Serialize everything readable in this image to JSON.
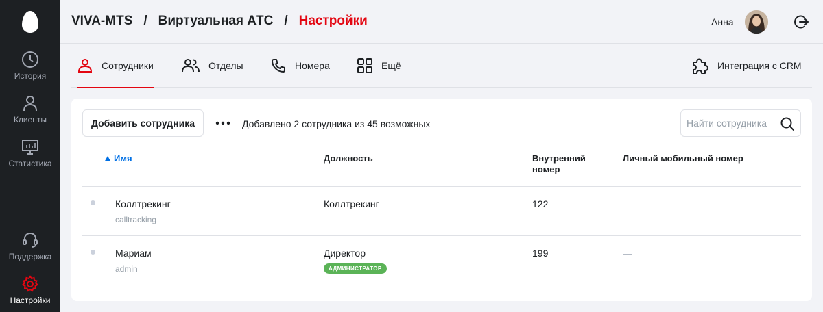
{
  "sidebar": {
    "items": [
      {
        "label": "История",
        "icon": "clock-icon"
      },
      {
        "label": "Клиенты",
        "icon": "person-icon"
      },
      {
        "label": "Статистика",
        "icon": "monitor-chart-icon"
      },
      {
        "label": "Поддержка",
        "icon": "headset-icon"
      },
      {
        "label": "Настройки",
        "icon": "gear-icon",
        "active": true
      }
    ]
  },
  "header": {
    "breadcrumb": [
      "VIVA-MTS",
      "Виртуальная АТС",
      "Настройки"
    ],
    "separator": "/",
    "user_name": "Анна"
  },
  "tabs": [
    {
      "label": "Сотрудники",
      "icon": "employee-icon",
      "active": true
    },
    {
      "label": "Отделы",
      "icon": "people-icon"
    },
    {
      "label": "Номера",
      "icon": "phone-icon"
    },
    {
      "label": "Ещё",
      "icon": "grid-icon"
    },
    {
      "label": "Интеграция с CRM",
      "icon": "puzzle-icon"
    }
  ],
  "toolbar": {
    "add_label": "Добавить сотрудника",
    "added_text": "Добавлено 2 сотрудника из 45 возможных",
    "search_placeholder": "Найти сотрудника"
  },
  "table": {
    "headers": {
      "name": "Имя",
      "position": "Должность",
      "ext_line1": "Внутренний",
      "ext_line2": "номер",
      "mobile": "Личный мобильный номер"
    },
    "rows": [
      {
        "name": "Коллтрекинг",
        "login": "calltracking",
        "position": "Коллтрекинг",
        "badge": "",
        "ext": "122",
        "mobile": "—"
      },
      {
        "name": "Мариам",
        "login": "admin",
        "position": "Директор",
        "badge": "АДМИНИСТРАТОР",
        "ext": "199",
        "mobile": "—"
      }
    ]
  },
  "colors": {
    "accent": "#e30611",
    "sort_blue": "#0070e5",
    "badge_green": "#5bb357",
    "sidebar_bg": "#1d2023"
  }
}
